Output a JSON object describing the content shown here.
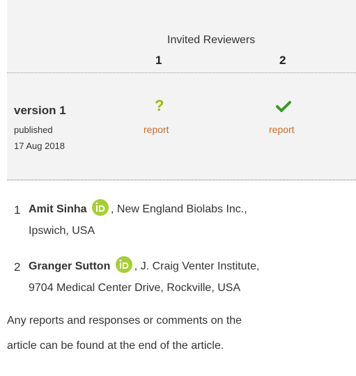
{
  "header": {
    "title": "Invited Reviewers"
  },
  "columns": [
    "1",
    "2"
  ],
  "version": {
    "title": "version 1",
    "status": "published",
    "date": "17 Aug 2018",
    "reports": [
      {
        "status_icon": "question-mark-icon",
        "label": "report",
        "color": "#a0b60f"
      },
      {
        "status_icon": "checkmark-icon",
        "label": "report",
        "color": "#3a9a26"
      }
    ]
  },
  "reviewers": [
    {
      "number": "1",
      "name": "Amit Sinha",
      "affiliation_line1": ", New England Biolabs Inc.,",
      "affiliation_line2": "Ipswich, USA",
      "icon": "orcid-icon"
    },
    {
      "number": "2",
      "name": "Granger Sutton",
      "affiliation_line1": ", J. Craig Venter Institute,",
      "affiliation_line2": "9704 Medical Center Drive, Rockville, USA",
      "icon": "orcid-icon"
    }
  ],
  "note": {
    "line1": "Any reports and responses or comments on the",
    "line2": "article can be found at the end of the article."
  },
  "colors": {
    "link": "#c96c2b",
    "orcid": "#a6ce39",
    "panel": "#f3f3f3"
  }
}
